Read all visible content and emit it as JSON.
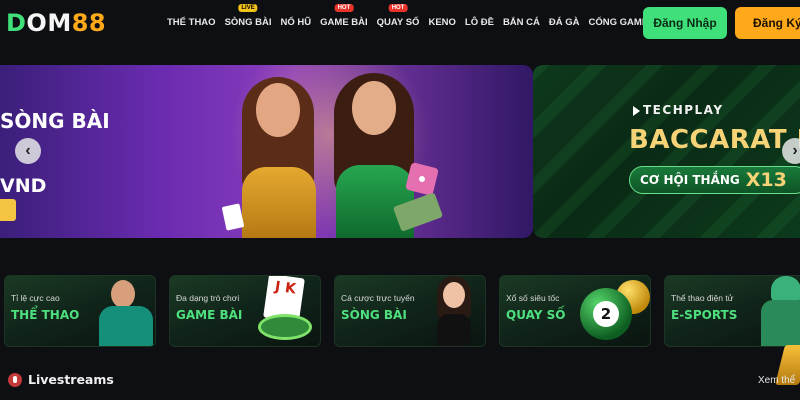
{
  "brand": {
    "logo_part1": "D",
    "logo_part2": "OM",
    "logo_part3": "88"
  },
  "nav": {
    "items": [
      {
        "label": "THỂ THAO",
        "badge": ""
      },
      {
        "label": "SÒNG BÀI",
        "badge": "LIVE"
      },
      {
        "label": "NỔ HŨ",
        "badge": ""
      },
      {
        "label": "GAME BÀI",
        "badge": "HOT"
      },
      {
        "label": "QUAY SỐ",
        "badge": "HOT"
      },
      {
        "label": "KENO",
        "badge": ""
      },
      {
        "label": "LÔ ĐỀ",
        "badge": ""
      },
      {
        "label": "BẮN CÁ",
        "badge": ""
      },
      {
        "label": "ĐÁ GÀ",
        "badge": ""
      },
      {
        "label": "CỔNG GAME",
        "badge": ""
      }
    ]
  },
  "auth": {
    "login_label": "Đăng Nhập",
    "register_label": "Đăng Ký"
  },
  "banners": {
    "left": {
      "title": "SÒNG BÀI",
      "amount": "VND"
    },
    "right": {
      "brand": "TECHPLAY",
      "title": "BACCARAT LI",
      "pill_text": "CƠ HỘI THẮNG",
      "multiplier": "X13"
    }
  },
  "categories": [
    {
      "sub": "Tỉ lệ cực cao",
      "main": "THỂ THAO"
    },
    {
      "sub": "Đa dạng trò chơi",
      "main": "GAME BÀI"
    },
    {
      "sub": "Cá cược trực tuyến",
      "main": "SÒNG BÀI"
    },
    {
      "sub": "Xổ số siêu tốc",
      "main": "QUAY SỐ"
    },
    {
      "sub": "Thể thao điện tử",
      "main": "E-SPORTS"
    }
  ],
  "card_letters": "J K",
  "ball_number": "2",
  "livestreams": {
    "title": "Livestreams",
    "see_all": "Xem thể"
  },
  "colors": {
    "accent_green": "#3fe07a",
    "accent_orange": "#ffa81a",
    "background": "#0e0f12"
  }
}
